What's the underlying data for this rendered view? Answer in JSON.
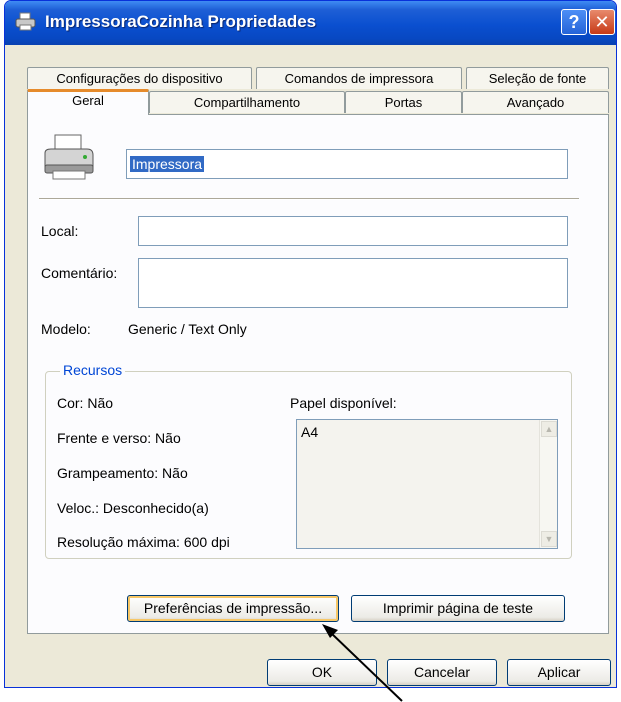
{
  "window": {
    "title": "ImpressoraCozinha Propriedades",
    "help_label": "?",
    "close_label": "✕"
  },
  "tabs_row1": [
    {
      "label": "Configurações do dispositivo"
    },
    {
      "label": "Comandos de impressora"
    },
    {
      "label": "Seleção de fonte"
    }
  ],
  "tabs_row2": [
    {
      "label": "Geral",
      "active": true
    },
    {
      "label": "Compartilhamento"
    },
    {
      "label": "Portas"
    },
    {
      "label": "Avançado"
    }
  ],
  "general": {
    "printer_name": "Impressora",
    "location_label": "Local:",
    "location_value": "",
    "comment_label": "Comentário:",
    "comment_value": "",
    "model_label": "Modelo:",
    "model_value": "Generic / Text Only"
  },
  "resources": {
    "title": "Recursos",
    "color": "Cor: Não",
    "duplex": "Frente e verso: Não",
    "staple": "Grampeamento: Não",
    "speed": "Veloc.: Desconhecido(a)",
    "max_resolution": "Resolução máxima: 600 dpi",
    "paper_label": "Papel disponível:",
    "paper_items": [
      "A4"
    ]
  },
  "buttons": {
    "preferences": "Preferências de impressão...",
    "test_page": "Imprimir página de teste",
    "ok": "OK",
    "cancel": "Cancelar",
    "apply": "Aplicar"
  },
  "icons": {
    "printer": "printer-icon",
    "title_printer": "printer-small-icon",
    "scroll_up": "scroll-up-arrow-icon",
    "scroll_down": "scroll-down-arrow-icon",
    "annotation_arrow": "annotation-arrow"
  },
  "colors": {
    "titlebar": "#0a4fd0",
    "dialog_bg": "#ece9d8",
    "active_tab_accent": "#e68b2c",
    "group_title": "#0046d5",
    "selection": "#316ac5"
  }
}
